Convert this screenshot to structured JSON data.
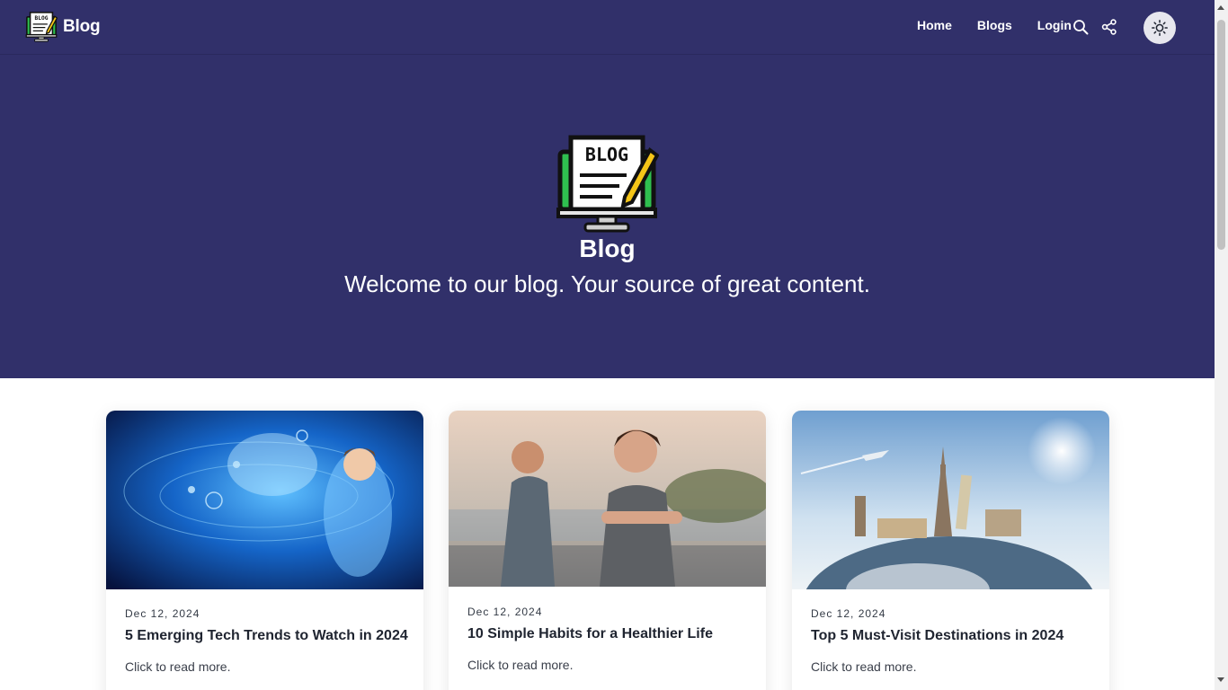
{
  "nav": {
    "brand": "Blog",
    "links": [
      "Home",
      "Blogs",
      "Login"
    ]
  },
  "hero": {
    "title": "Blog",
    "subtitle": "Welcome to our blog. Your source of great content."
  },
  "posts": [
    {
      "date": "Dec 12, 2024",
      "title": "5 Emerging Tech Trends to Watch in 2024",
      "desc": "Click to read more."
    },
    {
      "date": "Dec 12, 2024",
      "title": "10 Simple Habits for a Healthier Life",
      "desc": "Click to read more."
    },
    {
      "date": "Dec 12, 2024",
      "title": "Top 5 Must-Visit Destinations in 2024",
      "desc": "Click to read more."
    }
  ],
  "icons": {
    "logo": "blog-monitor-icon",
    "search": "search-icon",
    "share": "share-icon",
    "theme": "sun-icon"
  },
  "colors": {
    "nav_bg": "#31306a",
    "hero_bg": "#31306a",
    "logo_green": "#2fbf4f",
    "pencil_yellow": "#f5c518"
  }
}
